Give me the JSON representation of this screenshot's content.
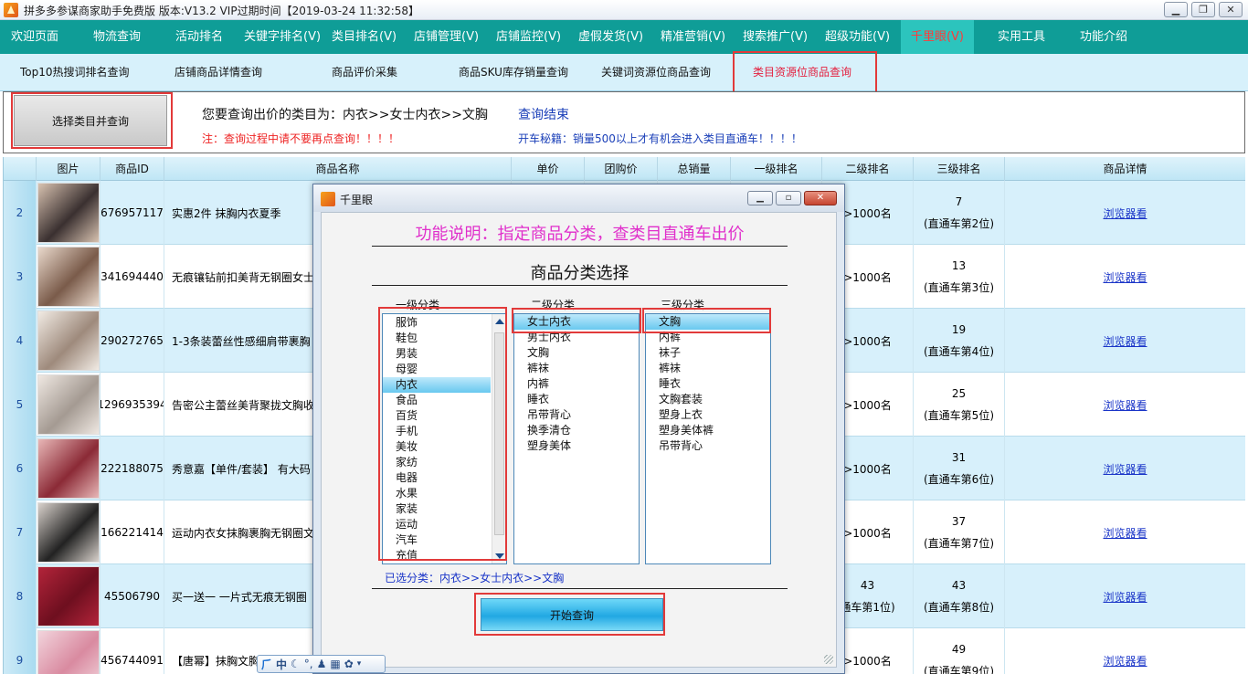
{
  "window": {
    "title": "拼多多参谋商家助手免费版 版本:V13.2 VIP过期时间【2019-03-24 11:32:58】"
  },
  "main_menu": [
    {
      "label": "欢迎页面"
    },
    {
      "label": "物流查询"
    },
    {
      "label": "活动排名"
    },
    {
      "label": "关键字排名(V)"
    },
    {
      "label": "类目排名(V)"
    },
    {
      "label": "店铺管理(V)"
    },
    {
      "label": "店铺监控(V)"
    },
    {
      "label": "虚假发货(V)"
    },
    {
      "label": "精准营销(V)"
    },
    {
      "label": "搜索推广(V)"
    },
    {
      "label": "超级功能(V)"
    },
    {
      "label": "千里眼(V)",
      "active": true
    },
    {
      "label": "实用工具"
    },
    {
      "label": "功能介绍"
    }
  ],
  "sub_menu": [
    {
      "label": "Top10热搜词排名查询"
    },
    {
      "label": "店铺商品详情查询"
    },
    {
      "label": "商品评价采集"
    },
    {
      "label": "商品SKU库存销量查询"
    },
    {
      "label": "关键词资源位商品查询"
    },
    {
      "label": "类目资源位商品查询",
      "active": true
    }
  ],
  "query": {
    "select_button": "选择类目并查询",
    "prompt": "您要查询出价的类目为：内衣>>女士内衣>>文胸",
    "end_status": "查询结束",
    "note": "注：查询过程中请不要再点查询！！！！",
    "tip": "开车秘籍：销量500以上才有机会进入类目直通车！！！！"
  },
  "table": {
    "columns": [
      "图片",
      "商品ID",
      "商品名称",
      "单价",
      "团购价",
      "总销量",
      "一级排名",
      "二级排名",
      "三级排名",
      "商品详情"
    ],
    "rows": [
      {
        "no": "2",
        "id": "676957117",
        "name": "实惠2件  抹胸内衣夏季",
        "rank2": ">1000名",
        "rank3a": "7",
        "rank3b": "(直通车第2位)",
        "detail": "浏览器看",
        "thumb": [
          "#d8c2b0",
          "#3a3030"
        ]
      },
      {
        "no": "3",
        "id": "341694440",
        "name": "无痕镶钻前扣美背无钢圈女士",
        "rank2": ">1000名",
        "rank3a": "13",
        "rank3b": "(直通车第3位)",
        "detail": "浏览器看",
        "thumb": [
          "#e9d9cc",
          "#7a5b4a"
        ]
      },
      {
        "no": "4",
        "id": "290272765",
        "name": "1-3条装蕾丝性感细肩带裹胸",
        "rank2": ">1000名",
        "rank3a": "19",
        "rank3b": "(直通车第4位)",
        "detail": "浏览器看",
        "thumb": [
          "#f1ebe4",
          "#9e8a7c"
        ]
      },
      {
        "no": "5",
        "id": "1296935394",
        "name": "告密公主蕾丝美背聚拢文胸收",
        "rank2": ">1000名",
        "rank3a": "25",
        "rank3b": "(直通车第5位)",
        "detail": "浏览器看",
        "thumb": [
          "#efe8e2",
          "#a49a92"
        ]
      },
      {
        "no": "6",
        "id": "222188075",
        "name": "秀意嘉【单件/套装】 有大码",
        "rank2": ">1000名",
        "rank3a": "31",
        "rank3b": "(直通车第6位)",
        "detail": "浏览器看",
        "thumb": [
          "#e8b7b7",
          "#8b2a36"
        ]
      },
      {
        "no": "7",
        "id": "166221414",
        "name": "运动内衣女抹胸裹胸无钢圈文",
        "rank2": ">1000名",
        "rank3a": "37",
        "rank3b": "(直通车第7位)",
        "detail": "浏览器看",
        "thumb": [
          "#d9d2cc",
          "#222"
        ]
      },
      {
        "no": "8",
        "id": "45506790",
        "name": "买一送一   一片式无痕无钢圈",
        "rank2a": "43",
        "rank2b": "通车第1位)",
        "rank3a": "43",
        "rank3b": "(直通车第8位)",
        "detail": "浏览器看",
        "thumb": [
          "#b3243a",
          "#6e0f1f"
        ]
      },
      {
        "no": "9",
        "id": "456744091",
        "name": "【唐幂】抹胸文胸",
        "rank2": ">1000名",
        "rank3a": "49",
        "rank3b": "(直通车第9位)",
        "detail": "浏览器看",
        "thumb": [
          "#f2d4dc",
          "#d98aa0"
        ]
      }
    ]
  },
  "modal": {
    "title": "千里眼",
    "function_desc": "功能说明：指定商品分类，查类目直通车出价",
    "section_title": "商品分类选择",
    "level1_label": "一级分类",
    "level2_label": "二级分类",
    "level3_label": "三级分类",
    "level1": [
      "服饰",
      "鞋包",
      "男装",
      "母婴",
      "内衣",
      "食品",
      "百货",
      "手机",
      "美妆",
      "家纺",
      "电器",
      "水果",
      "家装",
      "运动",
      "汽车",
      "充值"
    ],
    "level1_selected": "内衣",
    "level2": [
      "女士内衣",
      "男士内衣",
      "文胸",
      "裤袜",
      "内裤",
      "睡衣",
      "吊带背心",
      "换季清仓",
      "塑身美体"
    ],
    "level2_selected": "女士内衣",
    "level3": [
      "文胸",
      "内裤",
      "袜子",
      "裤袜",
      "睡衣",
      "文胸套装",
      "塑身上衣",
      "塑身美体裤",
      "吊带背心"
    ],
    "level3_selected": "文胸",
    "selected_path": "已选分类：内衣>>女士内衣>>文胸",
    "start_button": "开始查询"
  },
  "ime": {
    "label": "中"
  },
  "colors": {
    "menu_bg": "#0f9d97",
    "submenu_bg": "#d7f1fb",
    "highlight_red": "#e23a3a",
    "link_blue": "#1a35c8",
    "desc_magenta": "#e02ecb"
  }
}
